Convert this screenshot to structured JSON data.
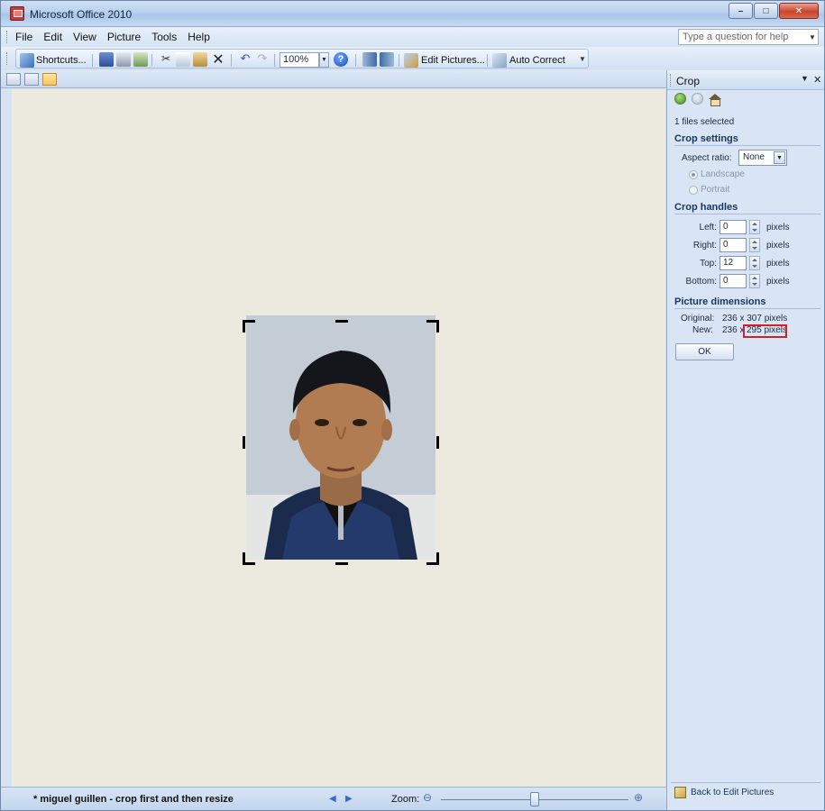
{
  "window": {
    "title": "Microsoft Office 2010"
  },
  "menu": {
    "items": [
      {
        "label": "File",
        "key": "F"
      },
      {
        "label": "Edit",
        "key": "E"
      },
      {
        "label": "View",
        "key": "V"
      },
      {
        "label": "Picture",
        "key": "P"
      },
      {
        "label": "Tools",
        "key": "T"
      },
      {
        "label": "Help",
        "key": "H"
      }
    ],
    "help_placeholder": "Type a question for help"
  },
  "toolbar": {
    "shortcuts_label": "Shortcuts...",
    "zoom_value": "100%",
    "edit_pictures_label": "Edit Pictures...",
    "auto_correct_label": "Auto Correct"
  },
  "status": {
    "filename": "* miguel guillen - crop first and then resize",
    "zoom_label": "Zoom:"
  },
  "zoom_slider": {
    "level": 0.5
  },
  "task_pane": {
    "title": "Crop",
    "files_selected": "1 files selected",
    "crop_settings_heading": "Crop settings",
    "aspect_ratio_label": "Aspect ratio:",
    "aspect_ratio_value": "None",
    "orientation": {
      "landscape": "Landscape",
      "portrait": "Portrait",
      "selected": "Landscape"
    },
    "crop_handles_heading": "Crop handles",
    "handles": [
      {
        "label": "Left:",
        "value": "0",
        "unit": "pixels"
      },
      {
        "label": "Right:",
        "value": "0",
        "unit": "pixels"
      },
      {
        "label": "Top:",
        "value": "12",
        "unit": "pixels"
      },
      {
        "label": "Bottom:",
        "value": "0",
        "unit": "pixels"
      }
    ],
    "picture_dimensions_heading": "Picture dimensions",
    "original_label": "Original:",
    "original_value": "236 x 307 pixels",
    "new_label": "New:",
    "new_value_prefix": "236 x",
    "new_value_highlight": "295 pixels",
    "ok_label": "OK",
    "back_link": "Back to Edit Pictures"
  },
  "colors": {
    "canvas": "#ece9de",
    "highlight": "#d2202a",
    "pane": "#d9e5f4"
  }
}
